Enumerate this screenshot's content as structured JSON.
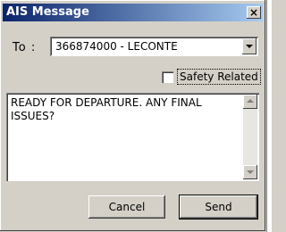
{
  "window": {
    "title": "AIS Message",
    "close_glyph": "×"
  },
  "to": {
    "label": "To :",
    "selected": "366874000 - LECONTE"
  },
  "safety": {
    "label": "Safety Related",
    "checked": false
  },
  "message": {
    "text": "READY FOR DEPARTURE. ANY FINAL ISSUES?"
  },
  "buttons": {
    "cancel": "Cancel",
    "send": "Send"
  },
  "icons": {
    "close": "close-icon",
    "dropdown": "chevron-down-icon",
    "scroll_up": "scroll-up-icon",
    "scroll_down": "scroll-down-icon"
  }
}
